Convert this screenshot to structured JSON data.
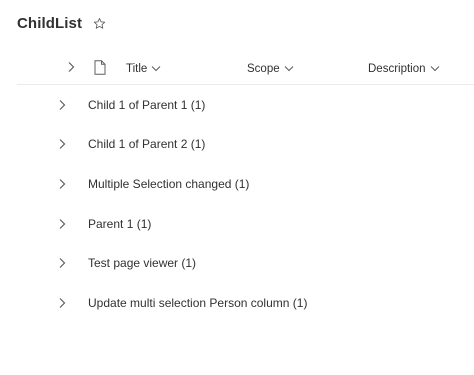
{
  "list": {
    "title": "ChildList",
    "favorite_icon": "star-outline-icon"
  },
  "header": {
    "expand_icon": "chevron-right-icon",
    "file_type_icon": "document-icon",
    "columns": [
      {
        "label": "Title",
        "icon": "chevron-down-icon"
      },
      {
        "label": "Scope",
        "icon": "chevron-down-icon"
      },
      {
        "label": "Description",
        "icon": "chevron-down-icon"
      }
    ]
  },
  "groups": [
    {
      "label": "Child 1 of Parent 1 (1)",
      "icon": "chevron-right-icon"
    },
    {
      "label": "Child 1 of Parent 2 (1)",
      "icon": "chevron-right-icon"
    },
    {
      "label": "Multiple Selection changed (1)",
      "icon": "chevron-right-icon"
    },
    {
      "label": "Parent 1 (1)",
      "icon": "chevron-right-icon"
    },
    {
      "label": "Test page viewer (1)",
      "icon": "chevron-right-icon"
    },
    {
      "label": "Update multi selection Person column (1)",
      "icon": "chevron-right-icon"
    }
  ]
}
